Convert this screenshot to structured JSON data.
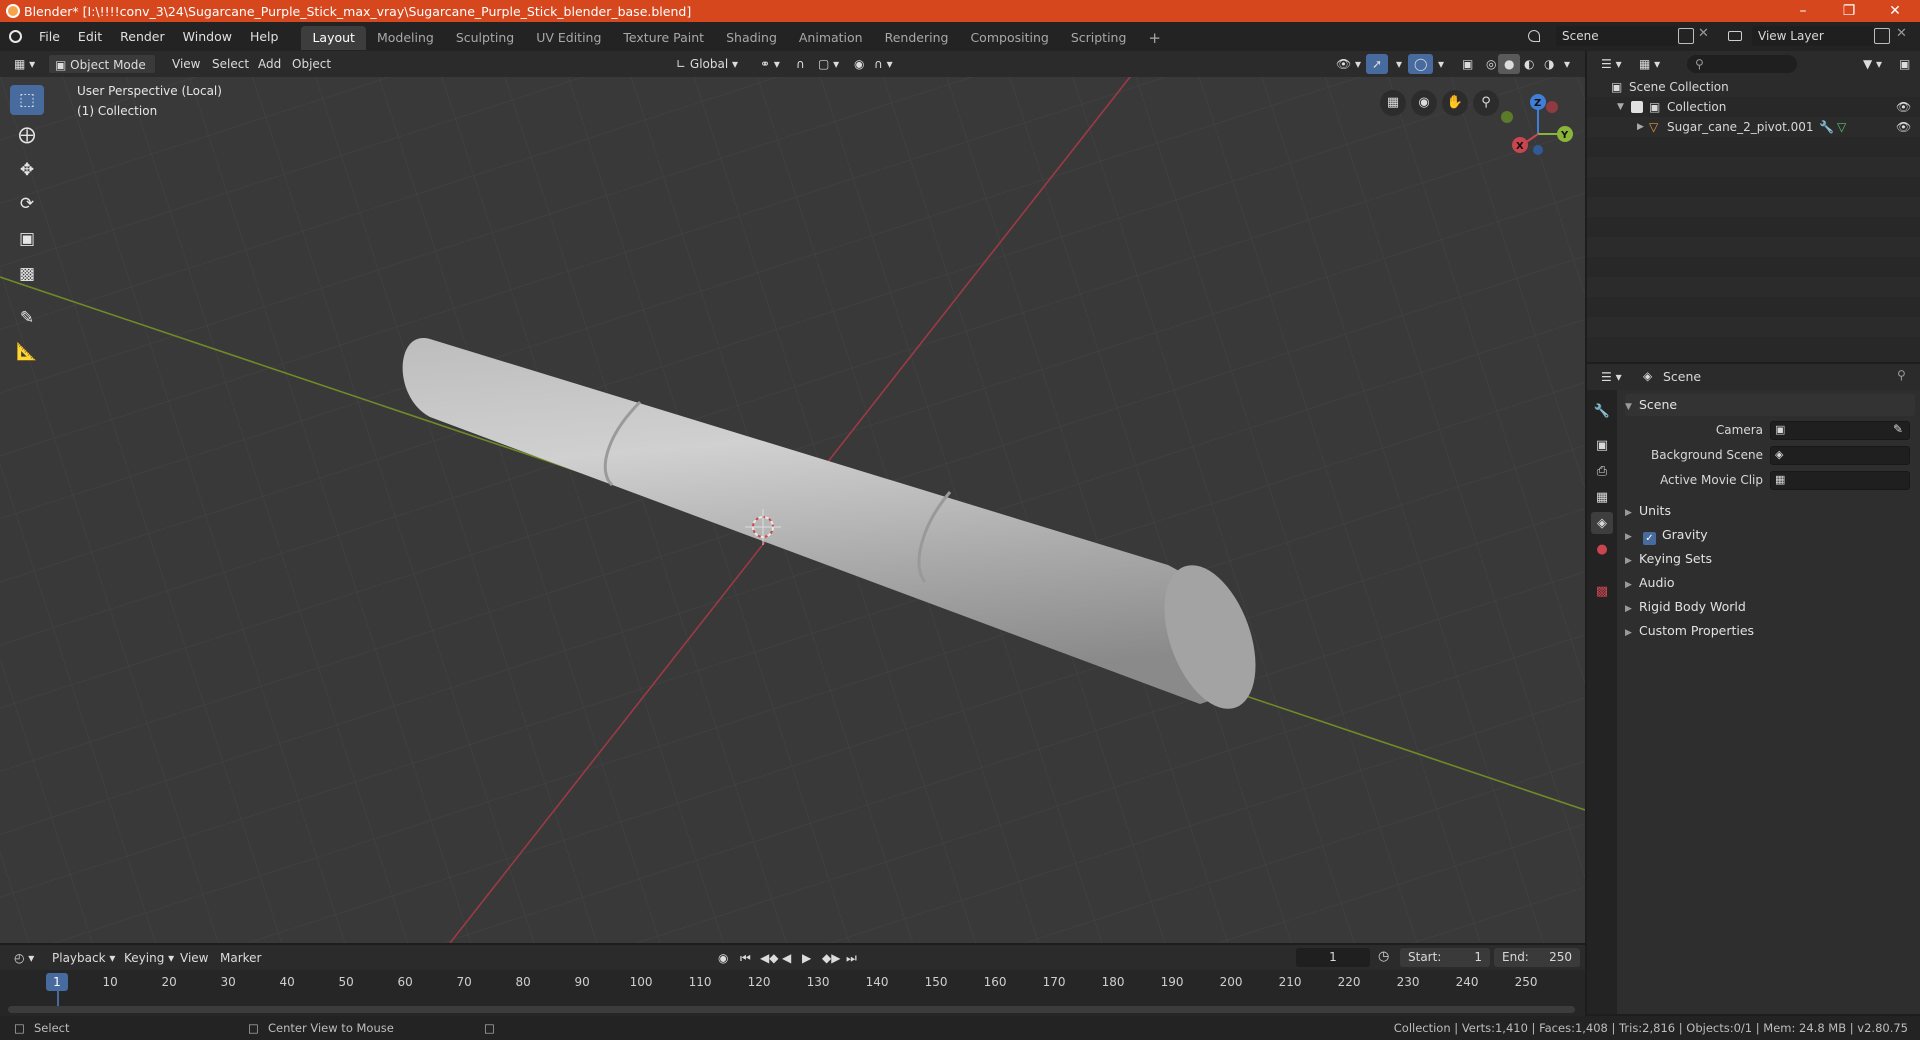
{
  "window": {
    "title": "Blender* [I:\\!!!!conv_3\\24\\Sugarcane_Purple_Stick_max_vray\\Sugarcane_Purple_Stick_blender_base.blend]"
  },
  "menu": [
    "File",
    "Edit",
    "Render",
    "Window",
    "Help"
  ],
  "workspaces": [
    "Layout",
    "Modeling",
    "Sculpting",
    "UV Editing",
    "Texture Paint",
    "Shading",
    "Animation",
    "Rendering",
    "Compositing",
    "Scripting"
  ],
  "active_workspace": "Layout",
  "top_right": {
    "scene": "Scene",
    "view_layer": "View Layer"
  },
  "viewport_header": {
    "mode": "Object Mode",
    "menus": [
      "View",
      "Select",
      "Add",
      "Object"
    ],
    "transform_orientation": "Global"
  },
  "viewport": {
    "perspective_label": "User Perspective (Local)",
    "collection_label": "(1) Collection",
    "gizmo_axes": {
      "x": "X",
      "y": "Y",
      "z": "Z"
    }
  },
  "outliner": {
    "root": "Scene Collection",
    "collection": "Collection",
    "object": "Sugar_cane_2_pivot.001"
  },
  "properties": {
    "header_title": "Scene",
    "panel_title": "Scene",
    "fields": [
      {
        "label": "Camera"
      },
      {
        "label": "Background Scene"
      },
      {
        "label": "Active Movie Clip"
      }
    ],
    "sections": [
      "Units",
      "Gravity",
      "Keying Sets",
      "Audio",
      "Rigid Body World",
      "Custom Properties"
    ]
  },
  "timeline": {
    "menus": [
      "Playback",
      "Keying",
      "View",
      "Marker"
    ],
    "current_frame": "1",
    "start_label": "Start:",
    "start": "1",
    "end_label": "End:",
    "end": "250",
    "ticks": [
      "1",
      "10",
      "20",
      "30",
      "40",
      "50",
      "60",
      "70",
      "80",
      "90",
      "100",
      "110",
      "120",
      "130",
      "140",
      "150",
      "160",
      "170",
      "180",
      "190",
      "200",
      "210",
      "220",
      "230",
      "240",
      "250"
    ]
  },
  "statusbar": {
    "left": "Select",
    "middle": "Center View to Mouse",
    "right": "Collection | Verts:1,410 | Faces:1,408 | Tris:2,816 | Objects:0/1 | Mem: 24.8 MB | v2.80.75"
  },
  "colors": {
    "titlebar": "#d6471e",
    "axis_x": "#c9454f",
    "axis_y": "#8ab43a",
    "axis_z": "#3f7fd8",
    "active_tool": "#476b9e"
  }
}
